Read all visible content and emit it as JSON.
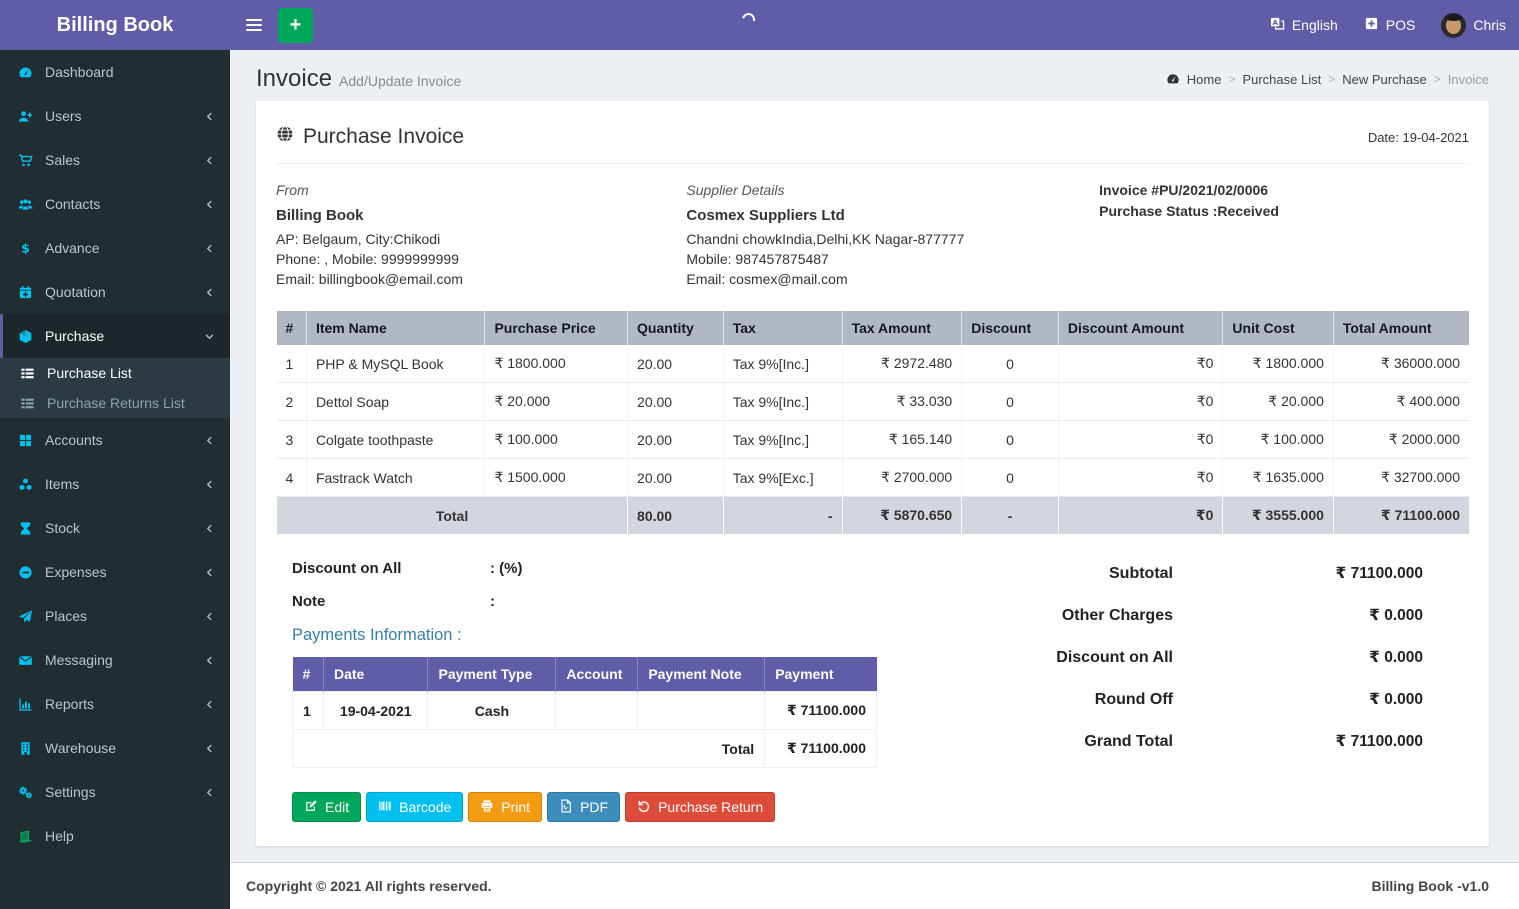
{
  "colors": {
    "primary": "#605ca8",
    "green": "#00a65a",
    "cyan": "#00c0ef",
    "orange": "#f39c12",
    "blue": "#3c8dbc",
    "red": "#dd4b39",
    "sidebar_bg": "#222d32"
  },
  "app": {
    "title": "Billing Book"
  },
  "topbar": {
    "language": "English",
    "pos": "POS",
    "user": "Chris"
  },
  "sidebar": {
    "items": [
      {
        "label": "Dashboard"
      },
      {
        "label": "Users"
      },
      {
        "label": "Sales"
      },
      {
        "label": "Contacts"
      },
      {
        "label": "Advance"
      },
      {
        "label": "Quotation"
      },
      {
        "label": "Purchase"
      },
      {
        "label": "Accounts"
      },
      {
        "label": "Items"
      },
      {
        "label": "Stock"
      },
      {
        "label": "Expenses"
      },
      {
        "label": "Places"
      },
      {
        "label": "Messaging"
      },
      {
        "label": "Reports"
      },
      {
        "label": "Warehouse"
      },
      {
        "label": "Settings"
      },
      {
        "label": "Help"
      }
    ],
    "purchase_submenu": [
      {
        "label": "Purchase List"
      },
      {
        "label": "Purchase Returns List"
      }
    ]
  },
  "page": {
    "title": "Invoice",
    "subtitle": "Add/Update Invoice",
    "breadcrumb": [
      "Home",
      "Purchase List",
      "New Purchase",
      "Invoice"
    ]
  },
  "invoice": {
    "card_title": "Purchase Invoice",
    "date": "Date: 19-04-2021",
    "from": {
      "heading": "From",
      "name": "Billing Book",
      "address": "AP: Belgaum, City:Chikodi",
      "phone": "Phone: , Mobile: 9999999999",
      "email": "Email: billingbook@email.com"
    },
    "supplier": {
      "heading": "Supplier Details",
      "name": "Cosmex Suppliers Ltd",
      "address": "Chandni chowkIndia,Delhi,KK Nagar-877777",
      "phone": "Mobile: 987457875487",
      "email": "Email: cosmex@mail.com"
    },
    "meta": {
      "number": "Invoice #PU/2021/02/0006",
      "status": "Purchase Status :Received"
    },
    "items_table": {
      "headers": [
        "#",
        "Item Name",
        "Purchase Price",
        "Quantity",
        "Tax",
        "Tax Amount",
        "Discount",
        "Discount Amount",
        "Unit Cost",
        "Total Amount"
      ],
      "rows": [
        {
          "n": "1",
          "name": "PHP & MySQL Book",
          "price": "₹ 1800.000",
          "qty": "20.00",
          "tax": "Tax 9%[Inc.]",
          "tax_amt": "₹ 2972.480",
          "disc": "0",
          "disc_amt": "₹0",
          "unit_cost": "₹ 1800.000",
          "total": "₹ 36000.000"
        },
        {
          "n": "2",
          "name": "Dettol Soap",
          "price": "₹ 20.000",
          "qty": "20.00",
          "tax": "Tax 9%[Inc.]",
          "tax_amt": "₹ 33.030",
          "disc": "0",
          "disc_amt": "₹0",
          "unit_cost": "₹ 20.000",
          "total": "₹ 400.000"
        },
        {
          "n": "3",
          "name": "Colgate toothpaste",
          "price": "₹ 100.000",
          "qty": "20.00",
          "tax": "Tax 9%[Inc.]",
          "tax_amt": "₹ 165.140",
          "disc": "0",
          "disc_amt": "₹0",
          "unit_cost": "₹ 100.000",
          "total": "₹ 2000.000"
        },
        {
          "n": "4",
          "name": "Fastrack Watch",
          "price": "₹ 1500.000",
          "qty": "20.00",
          "tax": "Tax 9%[Exc.]",
          "tax_amt": "₹ 2700.000",
          "disc": "0",
          "disc_amt": "₹0",
          "unit_cost": "₹ 1635.000",
          "total": "₹ 32700.000"
        }
      ],
      "total": {
        "label": "Total",
        "qty": "80.00",
        "tax": "-",
        "tax_amt": "₹ 5870.650",
        "disc": "-",
        "disc_amt": "₹0",
        "unit_cost": "₹ 3555.000",
        "total": "₹ 71100.000"
      }
    },
    "discount_on_all": {
      "label": "Discount on All",
      "value": ": (%)"
    },
    "note": {
      "label": "Note",
      "value": ":"
    },
    "payments": {
      "heading": "Payments Information :",
      "headers": [
        "#",
        "Date",
        "Payment Type",
        "Account",
        "Payment Note",
        "Payment"
      ],
      "rows": [
        {
          "n": "1",
          "date": "19-04-2021",
          "type": "Cash",
          "account": "",
          "note": "",
          "amount": "₹ 71100.000"
        }
      ],
      "total_label": "Total",
      "total_amount": "₹ 71100.000"
    },
    "summary": {
      "rows": [
        {
          "label": "Subtotal",
          "value": "₹ 71100.000"
        },
        {
          "label": "Other Charges",
          "value": "₹ 0.000"
        },
        {
          "label": "Discount on All",
          "value": "₹ 0.000"
        },
        {
          "label": "Round Off",
          "value": "₹ 0.000"
        },
        {
          "label": "Grand Total",
          "value": "₹ 71100.000"
        }
      ]
    },
    "actions": [
      {
        "label": "Edit"
      },
      {
        "label": "Barcode"
      },
      {
        "label": "Print"
      },
      {
        "label": "PDF"
      },
      {
        "label": "Purchase Return"
      }
    ]
  },
  "footer": {
    "copyright": "Copyright © 2021 All rights reserved.",
    "version": "Billing Book -v1.0"
  }
}
